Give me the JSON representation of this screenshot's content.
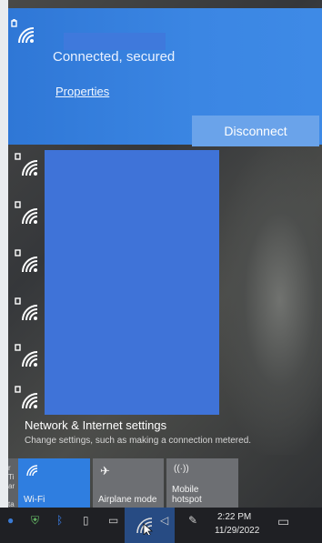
{
  "connection": {
    "status": "Connected, secured",
    "properties_link": "Properties",
    "disconnect_label": "Disconnect"
  },
  "network_list": {
    "count_visible": 6,
    "icon": "secured-wifi-icon"
  },
  "settings": {
    "title": "Network & Internet settings",
    "description": "Change settings, such as making a connection metered."
  },
  "quick_actions": [
    {
      "label": "Wi-Fi",
      "icon": "wifi-icon",
      "active": true
    },
    {
      "label": "Airplane mode",
      "icon": "airplane-icon",
      "active": false
    },
    {
      "label": "Mobile hotspot",
      "icon": "hotspot-icon",
      "active": false
    }
  ],
  "taskbar": {
    "time": "2:22 PM",
    "date": "11/29/2022"
  },
  "colors": {
    "accent": "#2f7ee0",
    "panel_blue": "#3b86e3",
    "taskbar": "#1f2024"
  }
}
